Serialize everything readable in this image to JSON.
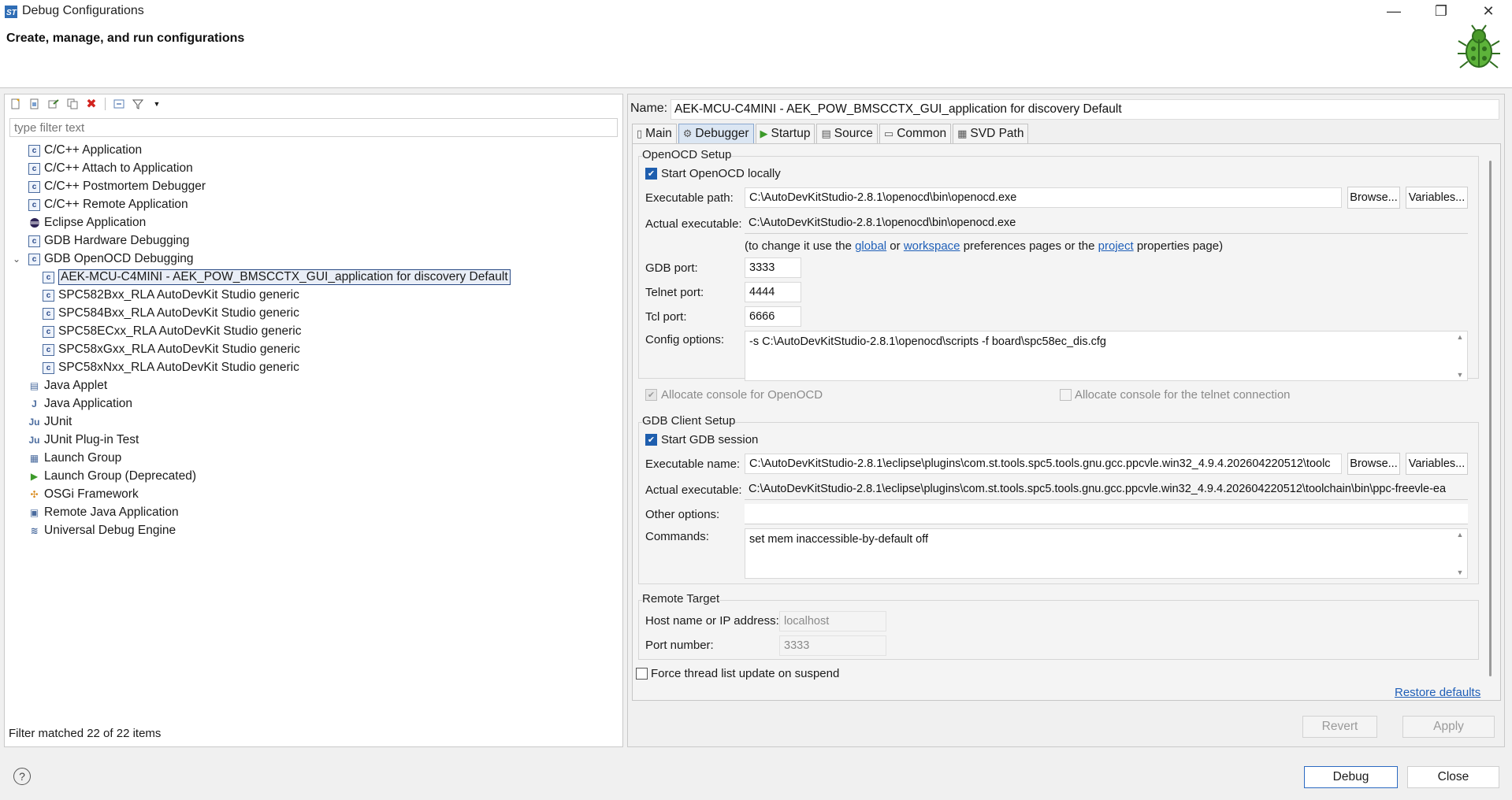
{
  "window": {
    "title": "Debug Configurations",
    "header_title": "Create, manage, and run configurations",
    "minimize_glyph": "—",
    "maximize_glyph": "❐",
    "close_glyph": "✕"
  },
  "left": {
    "filter_placeholder": "type filter text",
    "tree": [
      {
        "label": "C/C++ Application",
        "icon": "c-app-icon",
        "level": 0
      },
      {
        "label": "C/C++ Attach to Application",
        "icon": "c-app-icon",
        "level": 0
      },
      {
        "label": "C/C++ Postmortem Debugger",
        "icon": "c-app-icon",
        "level": 0
      },
      {
        "label": "C/C++ Remote Application",
        "icon": "c-app-icon",
        "level": 0
      },
      {
        "label": "Eclipse Application",
        "icon": "eclipse-icon",
        "level": 0
      },
      {
        "label": "GDB Hardware Debugging",
        "icon": "c-app-icon",
        "level": 0
      },
      {
        "label": "GDB OpenOCD Debugging",
        "icon": "c-app-icon",
        "level": 0,
        "expanded": true
      },
      {
        "label": "AEK-MCU-C4MINI - AEK_POW_BMSCCTX_GUI_application for discovery Default",
        "icon": "c-app-icon",
        "level": 1,
        "selected": true
      },
      {
        "label": "SPC582Bxx_RLA AutoDevKit Studio generic",
        "icon": "c-app-icon",
        "level": 1
      },
      {
        "label": "SPC584Bxx_RLA AutoDevKit Studio generic",
        "icon": "c-app-icon",
        "level": 1
      },
      {
        "label": "SPC58ECxx_RLA AutoDevKit Studio generic",
        "icon": "c-app-icon",
        "level": 1
      },
      {
        "label": "SPC58xGxx_RLA AutoDevKit Studio generic",
        "icon": "c-app-icon",
        "level": 1
      },
      {
        "label": "SPC58xNxx_RLA AutoDevKit Studio generic",
        "icon": "c-app-icon",
        "level": 1
      },
      {
        "label": "Java Applet",
        "icon": "java-applet-icon",
        "level": 0
      },
      {
        "label": "Java Application",
        "icon": "java-app-icon",
        "level": 0
      },
      {
        "label": "JUnit",
        "icon": "junit-icon",
        "level": 0
      },
      {
        "label": "JUnit Plug-in Test",
        "icon": "junit-plugin-icon",
        "level": 0
      },
      {
        "label": "Launch Group",
        "icon": "launch-group-icon",
        "level": 0
      },
      {
        "label": "Launch Group (Deprecated)",
        "icon": "play-icon",
        "level": 0
      },
      {
        "label": "OSGi Framework",
        "icon": "osgi-icon",
        "level": 0
      },
      {
        "label": "Remote Java Application",
        "icon": "remote-java-icon",
        "level": 0
      },
      {
        "label": "Universal Debug Engine",
        "icon": "ude-icon",
        "level": 0
      }
    ],
    "filter_status": "Filter matched 22 of 22 items"
  },
  "right": {
    "name_label": "Name:",
    "name_value": "AEK-MCU-C4MINI - AEK_POW_BMSCCTX_GUI_application for discovery Default",
    "tabs": [
      {
        "label": "Main",
        "icon": "main-tab-icon"
      },
      {
        "label": "Debugger",
        "icon": "debugger-tab-icon",
        "active": true
      },
      {
        "label": "Startup",
        "icon": "startup-tab-icon"
      },
      {
        "label": "Source",
        "icon": "source-tab-icon"
      },
      {
        "label": "Common",
        "icon": "common-tab-icon"
      },
      {
        "label": "SVD Path",
        "icon": "svd-tab-icon"
      }
    ],
    "openocd": {
      "group_title": "OpenOCD Setup",
      "start_locally_label": "Start OpenOCD locally",
      "start_locally_checked": true,
      "exec_path_label": "Executable path:",
      "exec_path_value": "C:\\AutoDevKitStudio-2.8.1\\openocd\\bin\\openocd.exe",
      "browse_label": "Browse...",
      "variables_label": "Variables...",
      "actual_exec_label": "Actual executable:",
      "actual_exec_value": "C:\\AutoDevKitStudio-2.8.1\\openocd\\bin\\openocd.exe",
      "hint_prefix": "(to change it use the ",
      "hint_global": "global",
      "hint_or": " or ",
      "hint_workspace": "workspace",
      "hint_middle": " preferences pages or the ",
      "hint_project": "project",
      "hint_suffix": " properties page)",
      "gdb_port_label": "GDB port:",
      "gdb_port_value": "3333",
      "telnet_port_label": "Telnet port:",
      "telnet_port_value": "4444",
      "tcl_port_label": "Tcl port:",
      "tcl_port_value": "6666",
      "config_label": "Config options:",
      "config_value": "-s C:\\AutoDevKitStudio-2.8.1\\openocd\\scripts -f board\\spc58ec_dis.cfg",
      "alloc_console_label": "Allocate console for OpenOCD",
      "alloc_telnet_label": "Allocate console for the telnet connection"
    },
    "gdb_client": {
      "group_title": "GDB Client Setup",
      "start_session_label": "Start GDB session",
      "start_session_checked": true,
      "exec_name_label": "Executable name:",
      "exec_name_value": "C:\\AutoDevKitStudio-2.8.1\\eclipse\\plugins\\com.st.tools.spc5.tools.gnu.gcc.ppcvle.win32_4.9.4.202604220512\\toolc",
      "browse_label": "Browse...",
      "variables_label": "Variables...",
      "actual_exec_label": "Actual executable:",
      "actual_exec_value": "C:\\AutoDevKitStudio-2.8.1\\eclipse\\plugins\\com.st.tools.spc5.tools.gnu.gcc.ppcvle.win32_4.9.4.202604220512\\toolchain\\bin\\ppc-freevle-ea",
      "other_options_label": "Other options:",
      "other_options_value": "",
      "commands_label": "Commands:",
      "commands_value": "set mem inaccessible-by-default off"
    },
    "remote": {
      "group_title": "Remote Target",
      "host_label": "Host name or IP address:",
      "host_value": "localhost",
      "port_label": "Port number:",
      "port_value": "3333"
    },
    "force_thread_label": "Force thread list update on suspend",
    "restore_defaults": "Restore defaults",
    "revert_label": "Revert",
    "apply_label": "Apply"
  },
  "footer": {
    "help_glyph": "?",
    "debug_label": "Debug",
    "close_label": "Close"
  },
  "colors": {
    "accent": "#1e5eae",
    "link": "#1f5fb8",
    "selection_border": "#2b4b86"
  }
}
